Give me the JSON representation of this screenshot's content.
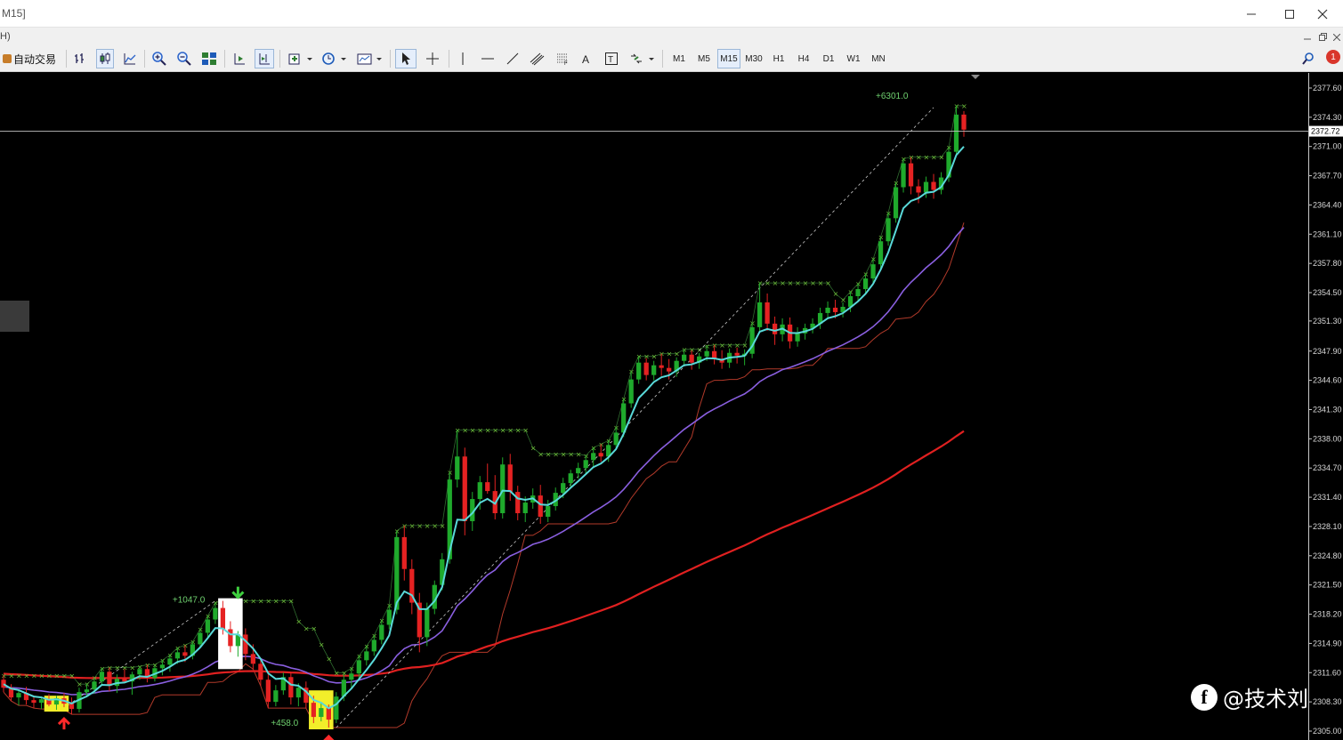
{
  "window": {
    "title": "M15]",
    "menu_fragment": "H)"
  },
  "toolbar": {
    "autotrade_label": "自动交易",
    "timeframes": [
      "M1",
      "M5",
      "M15",
      "M30",
      "H1",
      "H4",
      "D1",
      "W1",
      "MN"
    ],
    "active_timeframe": "M15",
    "alert_count": "1"
  },
  "chart_data": {
    "type": "candlestick",
    "instrument_timeframe": "M15",
    "y_axis": {
      "ylim": [
        2305.0,
        2378.5
      ],
      "tick_labels": [
        "2377.60",
        "2374.30",
        "2371.00",
        "2367.70",
        "2364.40",
        "2361.10",
        "2357.80",
        "2354.50",
        "2351.30",
        "2347.90",
        "2344.60",
        "2341.30",
        "2338.00",
        "2334.70",
        "2331.40",
        "2328.10",
        "2324.80",
        "2321.50",
        "2318.20",
        "2314.90",
        "2311.60",
        "2308.30",
        "2305.00"
      ]
    },
    "current_price": "2372.72",
    "candles_ohlc": [
      [
        2310.8,
        2311.3,
        2309.4,
        2309.9
      ],
      [
        2309.9,
        2310.3,
        2308.4,
        2308.8
      ],
      [
        2308.8,
        2309.7,
        2307.9,
        2309.3
      ],
      [
        2309.3,
        2310.0,
        2308.0,
        2308.5
      ],
      [
        2308.5,
        2309.0,
        2307.6,
        2308.2
      ],
      [
        2308.2,
        2308.9,
        2307.5,
        2308.6
      ],
      [
        2308.6,
        2309.2,
        2307.8,
        2308.0
      ],
      [
        2308.0,
        2309.0,
        2307.4,
        2308.7
      ],
      [
        2308.7,
        2309.3,
        2307.7,
        2308.1
      ],
      [
        2308.1,
        2308.8,
        2306.9,
        2307.5
      ],
      [
        2307.5,
        2309.9,
        2307.1,
        2309.4
      ],
      [
        2309.4,
        2310.3,
        2308.8,
        2309.7
      ],
      [
        2309.7,
        2311.0,
        2309.2,
        2310.6
      ],
      [
        2310.6,
        2312.1,
        2310.2,
        2311.7
      ],
      [
        2311.7,
        2312.2,
        2309.5,
        2310.1
      ],
      [
        2310.1,
        2311.4,
        2309.3,
        2310.9
      ],
      [
        2310.9,
        2312.0,
        2310.4,
        2310.6
      ],
      [
        2310.6,
        2311.7,
        2309.1,
        2311.4
      ],
      [
        2311.4,
        2312.3,
        2310.8,
        2312.0
      ],
      [
        2312.0,
        2312.5,
        2310.5,
        2311.0
      ],
      [
        2311.0,
        2312.4,
        2310.6,
        2312.1
      ],
      [
        2312.1,
        2313.0,
        2311.3,
        2312.5
      ],
      [
        2312.5,
        2313.6,
        2311.7,
        2313.2
      ],
      [
        2313.2,
        2314.4,
        2312.6,
        2313.9
      ],
      [
        2313.9,
        2314.7,
        2312.8,
        2313.5
      ],
      [
        2313.5,
        2315.1,
        2313.1,
        2314.8
      ],
      [
        2314.8,
        2316.5,
        2314.4,
        2316.1
      ],
      [
        2316.1,
        2318.0,
        2315.6,
        2317.6
      ],
      [
        2317.6,
        2319.5,
        2317.1,
        2318.9
      ],
      [
        2318.9,
        2319.7,
        2315.9,
        2316.5
      ],
      [
        2316.5,
        2317.4,
        2313.9,
        2314.6
      ],
      [
        2314.6,
        2316.3,
        2313.4,
        2315.9
      ],
      [
        2315.9,
        2316.6,
        2313.0,
        2313.7
      ],
      [
        2313.7,
        2314.8,
        2312.0,
        2312.6
      ],
      [
        2312.6,
        2313.2,
        2310.1,
        2310.8
      ],
      [
        2310.8,
        2311.5,
        2307.6,
        2308.3
      ],
      [
        2308.3,
        2310.2,
        2307.8,
        2309.6
      ],
      [
        2309.6,
        2311.6,
        2309.1,
        2311.1
      ],
      [
        2311.1,
        2311.6,
        2308.0,
        2308.8
      ],
      [
        2308.8,
        2310.4,
        2307.8,
        2309.9
      ],
      [
        2309.9,
        2310.6,
        2307.6,
        2308.2
      ],
      [
        2308.2,
        2309.0,
        2305.9,
        2306.6
      ],
      [
        2306.6,
        2308.3,
        2306.1,
        2307.6
      ],
      [
        2307.6,
        2308.0,
        2305.4,
        2306.3
      ],
      [
        2306.3,
        2309.4,
        2305.9,
        2308.9
      ],
      [
        2308.9,
        2311.4,
        2308.4,
        2310.8
      ],
      [
        2310.8,
        2312.1,
        2309.8,
        2311.5
      ],
      [
        2311.5,
        2313.5,
        2310.9,
        2313.0
      ],
      [
        2313.0,
        2314.6,
        2312.4,
        2314.0
      ],
      [
        2314.0,
        2315.8,
        2313.5,
        2315.3
      ],
      [
        2315.3,
        2317.5,
        2314.8,
        2317.0
      ],
      [
        2317.0,
        2319.2,
        2316.5,
        2318.7
      ],
      [
        2318.7,
        2327.6,
        2318.2,
        2326.9
      ],
      [
        2326.9,
        2328.2,
        2322.0,
        2323.3
      ],
      [
        2323.3,
        2324.4,
        2318.2,
        2319.5
      ],
      [
        2319.5,
        2320.6,
        2313.9,
        2315.6
      ],
      [
        2315.6,
        2319.5,
        2314.6,
        2318.8
      ],
      [
        2318.8,
        2322.0,
        2318.2,
        2321.5
      ],
      [
        2321.5,
        2325.1,
        2320.9,
        2324.4
      ],
      [
        2324.4,
        2334.2,
        2323.9,
        2333.4
      ],
      [
        2333.4,
        2339.0,
        2332.5,
        2336.0
      ],
      [
        2336.0,
        2337.0,
        2327.1,
        2328.7
      ],
      [
        2328.7,
        2332.0,
        2327.6,
        2331.2
      ],
      [
        2331.2,
        2333.8,
        2330.0,
        2333.1
      ],
      [
        2333.1,
        2335.2,
        2331.8,
        2332.1
      ],
      [
        2332.1,
        2333.9,
        2328.9,
        2329.6
      ],
      [
        2329.6,
        2335.9,
        2329.0,
        2335.1
      ],
      [
        2335.1,
        2336.3,
        2331.0,
        2332.0
      ],
      [
        2332.0,
        2332.7,
        2328.8,
        2329.6
      ],
      [
        2329.6,
        2331.5,
        2328.6,
        2330.8
      ],
      [
        2330.8,
        2332.4,
        2330.1,
        2331.6
      ],
      [
        2331.6,
        2332.8,
        2328.4,
        2329.2
      ],
      [
        2329.2,
        2331.1,
        2328.6,
        2330.4
      ],
      [
        2330.4,
        2332.5,
        2329.9,
        2331.9
      ],
      [
        2331.9,
        2333.6,
        2331.3,
        2333.0
      ],
      [
        2333.0,
        2334.5,
        2332.4,
        2334.1
      ],
      [
        2334.1,
        2335.3,
        2333.5,
        2334.7
      ],
      [
        2334.7,
        2336.1,
        2334.1,
        2335.6
      ],
      [
        2335.6,
        2337.0,
        2334.9,
        2336.4
      ],
      [
        2336.4,
        2337.4,
        2335.4,
        2336.0
      ],
      [
        2336.0,
        2337.8,
        2335.4,
        2337.3
      ],
      [
        2337.3,
        2339.3,
        2336.8,
        2338.7
      ],
      [
        2338.7,
        2342.5,
        2338.2,
        2342.0
      ],
      [
        2342.0,
        2345.6,
        2341.5,
        2344.7
      ],
      [
        2344.7,
        2347.3,
        2344.2,
        2346.6
      ],
      [
        2346.6,
        2347.1,
        2344.6,
        2345.2
      ],
      [
        2345.2,
        2346.8,
        2344.6,
        2346.3
      ],
      [
        2346.3,
        2347.6,
        2345.1,
        2346.0
      ],
      [
        2346.0,
        2347.0,
        2344.7,
        2345.6
      ],
      [
        2345.6,
        2347.2,
        2345.0,
        2346.8
      ],
      [
        2346.8,
        2348.1,
        2346.2,
        2347.5
      ],
      [
        2347.5,
        2348.0,
        2345.8,
        2346.6
      ],
      [
        2346.6,
        2347.7,
        2345.9,
        2347.3
      ],
      [
        2347.3,
        2348.5,
        2346.8,
        2347.9
      ],
      [
        2347.9,
        2348.6,
        2346.4,
        2347.0
      ],
      [
        2347.0,
        2348.0,
        2345.9,
        2346.6
      ],
      [
        2346.6,
        2348.2,
        2346.0,
        2347.7
      ],
      [
        2347.7,
        2348.3,
        2346.5,
        2347.4
      ],
      [
        2347.4,
        2348.1,
        2346.3,
        2347.6
      ],
      [
        2347.6,
        2351.1,
        2347.1,
        2350.6
      ],
      [
        2350.6,
        2355.6,
        2350.1,
        2353.4
      ],
      [
        2353.4,
        2354.4,
        2350.2,
        2351.0
      ],
      [
        2351.0,
        2351.8,
        2348.6,
        2349.8
      ],
      [
        2349.8,
        2351.6,
        2349.0,
        2350.9
      ],
      [
        2350.9,
        2351.7,
        2348.2,
        2349.0
      ],
      [
        2349.0,
        2350.6,
        2348.4,
        2349.9
      ],
      [
        2349.9,
        2351.0,
        2349.2,
        2350.5
      ],
      [
        2350.5,
        2351.6,
        2349.9,
        2351.0
      ],
      [
        2351.0,
        2352.8,
        2350.4,
        2352.2
      ],
      [
        2352.2,
        2353.5,
        2351.5,
        2352.8
      ],
      [
        2352.8,
        2353.7,
        2351.6,
        2352.3
      ],
      [
        2352.3,
        2353.4,
        2351.7,
        2352.9
      ],
      [
        2352.9,
        2354.6,
        2352.3,
        2354.1
      ],
      [
        2354.1,
        2355.5,
        2353.5,
        2354.9
      ],
      [
        2354.9,
        2356.6,
        2354.3,
        2356.1
      ],
      [
        2356.1,
        2358.3,
        2355.6,
        2357.7
      ],
      [
        2357.7,
        2360.8,
        2357.2,
        2360.3
      ],
      [
        2360.3,
        2363.5,
        2359.8,
        2362.9
      ],
      [
        2362.9,
        2366.9,
        2362.4,
        2366.4
      ],
      [
        2366.4,
        2369.6,
        2365.8,
        2369.1
      ],
      [
        2369.1,
        2369.8,
        2365.6,
        2366.5
      ],
      [
        2366.5,
        2367.3,
        2364.6,
        2365.8
      ],
      [
        2365.8,
        2367.6,
        2365.2,
        2367.0
      ],
      [
        2367.0,
        2367.9,
        2365.1,
        2366.1
      ],
      [
        2366.1,
        2368.1,
        2365.6,
        2367.5
      ],
      [
        2367.5,
        2370.9,
        2367.0,
        2370.4
      ],
      [
        2370.4,
        2375.6,
        2369.9,
        2374.6
      ],
      [
        2374.6,
        2375.0,
        2372.1,
        2372.9
      ]
    ],
    "ma_fast_color": "#59d9d9",
    "ma_mid_color": "#8a5fe0",
    "ma_slow_color": "#e02020",
    "channel_color": "#b23a2a",
    "up_color": "#1faa2c",
    "down_color": "#e52222",
    "annotations": [
      {
        "text": "+1047.0",
        "price": 2319.5
      },
      {
        "text": "+458.0",
        "price": 2305.6
      },
      {
        "text": "+6301.0",
        "price": 2376.4
      }
    ]
  },
  "watermark": {
    "logo": "f",
    "text": "@技术刘"
  }
}
